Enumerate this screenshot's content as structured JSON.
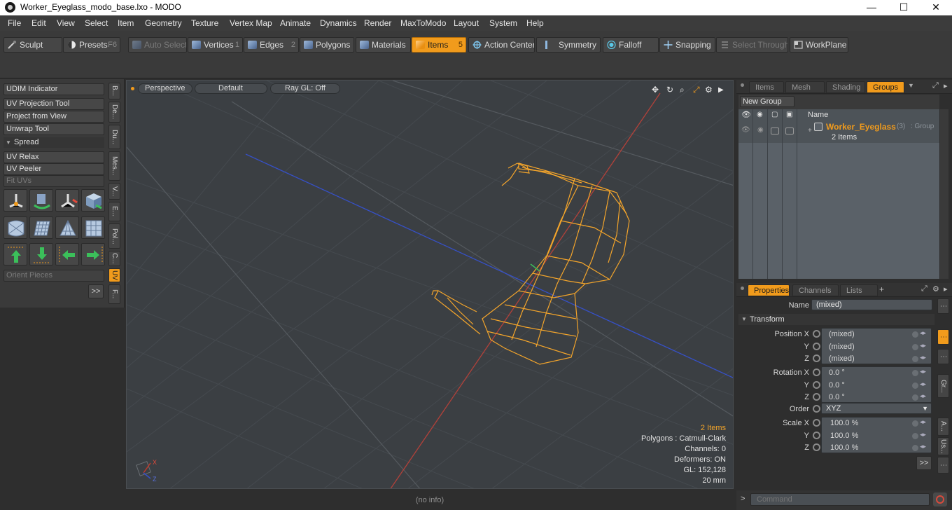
{
  "window": {
    "title": "Worker_Eyeglass_modo_base.lxo - MODO",
    "minimize": "—",
    "maximize": "☐",
    "close": "✕"
  },
  "menu": [
    "File",
    "Edit",
    "View",
    "Select",
    "Item",
    "Geometry",
    "Texture",
    "Vertex Map",
    "Animate",
    "Dynamics",
    "Render",
    "MaxToModo",
    "Layout",
    "System",
    "Help"
  ],
  "toolbar": {
    "sculpt": "Sculpt",
    "presets": "Presets",
    "presets_key": "F6",
    "auto_select": "Auto Select",
    "vertices": "Vertices",
    "vertices_key": "1",
    "edges": "Edges",
    "edges_key": "2",
    "polygons": "Polygons",
    "materials": "Materials",
    "items": "Items",
    "items_key": "5",
    "action_center": "Action Center",
    "symmetry": "Symmetry",
    "falloff": "Falloff",
    "snapping": "Snapping",
    "select_through": "Select Through",
    "workplane": "WorkPlane"
  },
  "left_panel": {
    "udim": "UDIM Indicator",
    "uv_projection": "UV Projection Tool",
    "project_view": "Project from View",
    "unwrap": "Unwrap Tool",
    "spread": "Spread",
    "uv_relax": "UV Relax",
    "uv_peeler": "UV Peeler",
    "fit_uvs": "Fit UVs",
    "orient": "Orient Pieces",
    "more": ">>",
    "vtabs": [
      "B...",
      "De...",
      "Du...",
      "Mes...",
      "V...",
      "E...",
      "Pol...",
      "C...",
      "UV",
      "F..."
    ]
  },
  "viewport": {
    "view": "Perspective",
    "shading": "Default",
    "renderer": "Ray GL: Off",
    "info_items": "2 Items",
    "info_polygons": "Polygons : Catmull-Clark",
    "info_channels": "Channels: 0",
    "info_deformers": "Deformers: ON",
    "info_gl": "GL: 152,128",
    "info_scale": "20 mm",
    "axis_x": "X",
    "axis_z": "Z"
  },
  "status": "(no info)",
  "groups": {
    "tabs": [
      "Items",
      "Mesh ...",
      "Shading",
      "Groups"
    ],
    "new_group": "New Group",
    "col_name": "Name",
    "group_name": "Worker_Eyeglass",
    "group_count": "(3)",
    "group_type": ": Group",
    "group_items": "2 Items"
  },
  "properties": {
    "tabs": [
      "Properties",
      "Channels",
      "Lists"
    ],
    "add_tab": "+",
    "name_label": "Name",
    "name_value": "(mixed)",
    "transform": "Transform",
    "position_x_label": "Position X",
    "y_label": "Y",
    "z_label": "Z",
    "pos_x": "(mixed)",
    "pos_y": "(mixed)",
    "pos_z": "(mixed)",
    "rotation_x_label": "Rotation X",
    "rot_x": "0.0 °",
    "rot_y": "0.0 °",
    "rot_z": "0.0 °",
    "order_label": "Order",
    "order_value": "XYZ",
    "scale_x_label": "Scale X",
    "scale_x": "100.0 %",
    "scale_y": "100.0 %",
    "scale_z": "100.0 %",
    "more": ">>",
    "side_tabs": [
      "Gr...",
      "A...",
      "Us..."
    ]
  },
  "command": {
    "prompt": ">",
    "placeholder": "Command"
  },
  "colors": {
    "accent": "#f19b1c",
    "wireframe": "#f4a52b",
    "axis_red": "#c0392b",
    "axis_blue": "#3650c8"
  }
}
